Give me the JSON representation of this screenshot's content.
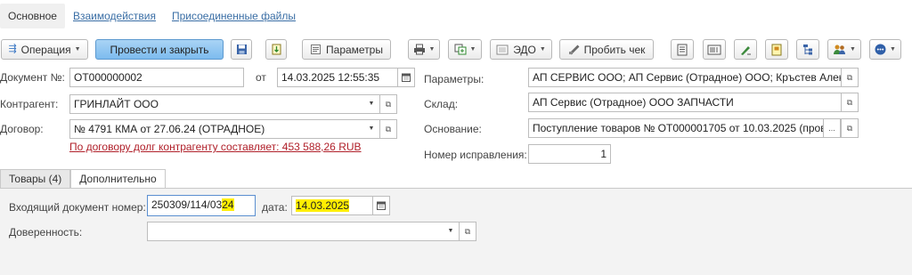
{
  "tabs": [
    "Основное",
    "Взаимодействия",
    "Присоединенные файлы"
  ],
  "toolbar": {
    "operation": "Операция",
    "post_close": "Провести и закрыть",
    "params": "Параметры",
    "edo": "ЭДО",
    "print_check": "Пробить чек"
  },
  "header": {
    "doc_label": "Документ №:",
    "doc_number": "ОТ000000002",
    "from_label": "от",
    "doc_date": "14.03.2025 12:55:35",
    "contractor_label": "Контрагент:",
    "contractor": "ГРИНЛАЙТ ООО",
    "contract_label": "Договор:",
    "contract": "№ 4791 КМА от 27.06.24 (ОТРАДНОЕ)",
    "debt_link": "По договору долг контрагенту составляет: 453 588,26 RUB",
    "params_label": "Параметры:",
    "params_value": "АП СЕРВИС ООО; АП Сервис (Отрадное) ООО; Кръстев Алек",
    "warehouse_label": "Склад:",
    "warehouse": "АП Сервис (Отрадное) ООО ЗАПЧАСТИ",
    "basis_label": "Основание:",
    "basis": "Поступление товаров № ОТ000001705 от 10.03.2025 (пров",
    "basis_more": "...",
    "fix_label": "Номер исправления:",
    "fix_number": "1"
  },
  "subtabs": [
    "Товары (4)",
    "Дополнительно"
  ],
  "extra": {
    "incoming_label": "Входящий документ номер:",
    "incoming_prefix": "250309/114/03",
    "incoming_highlight": "24",
    "date_label": "дата:",
    "date_value": "14.03.2025",
    "proxy_label": "Доверенность:"
  },
  "colors": {
    "primary_button": "#7dbbee",
    "link": "#3a6ea5",
    "warning_link": "#b0202a",
    "highlight": "#ffee00"
  },
  "icons": [
    "operation-icon",
    "save-icon",
    "post-icon",
    "params-icon",
    "print-icon",
    "create-based-icon",
    "edo-icon",
    "receipt-icon",
    "report-icon",
    "barcode-icon",
    "sign-icon",
    "note-icon",
    "structure-icon",
    "users-icon",
    "more-icon",
    "calendar-icon",
    "open-icon"
  ]
}
